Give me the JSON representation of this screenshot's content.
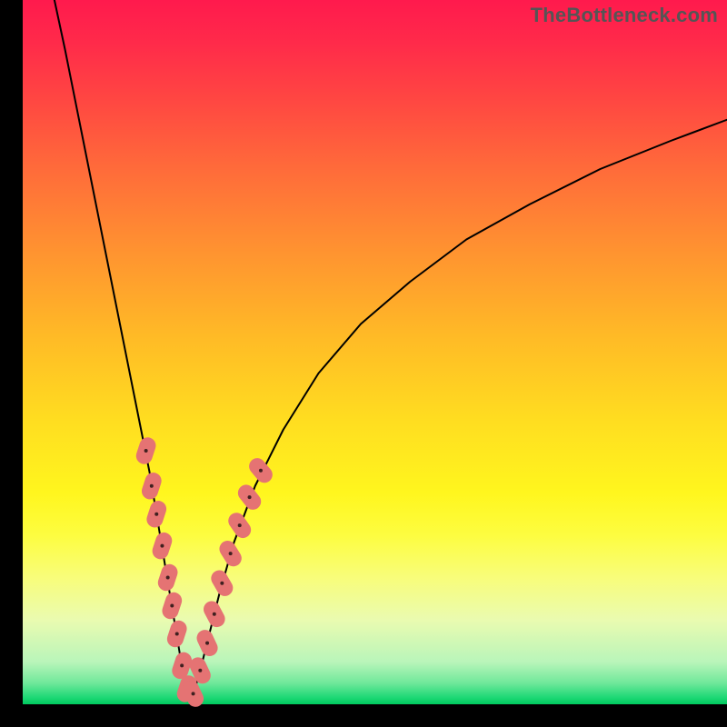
{
  "watermark": "TheBottleneck.com",
  "chart_data": {
    "type": "line",
    "title": "",
    "xlabel": "",
    "ylabel": "",
    "xlim": [
      0,
      100
    ],
    "ylim": [
      0,
      100
    ],
    "notes": "V-shaped bottleneck curve over a red-to-green vertical gradient. Minimum near x≈23.5. Salmon capsule markers cluster along both branches near bottom.",
    "series": [
      {
        "name": "left-branch",
        "x": [
          4.5,
          6,
          8,
          10,
          12,
          14,
          16,
          18,
          19.5,
          21,
          22,
          23,
          23.8
        ],
        "y": [
          100,
          93,
          83,
          73,
          63,
          53,
          43,
          33,
          24,
          15,
          9,
          3,
          0.3
        ]
      },
      {
        "name": "right-branch",
        "x": [
          23.8,
          25,
          26.5,
          28,
          30,
          33,
          37,
          42,
          48,
          55,
          63,
          72,
          82,
          92,
          100
        ],
        "y": [
          0.3,
          4,
          10,
          16,
          23,
          31,
          39,
          47,
          54,
          60,
          66,
          71,
          76,
          80,
          83
        ]
      }
    ],
    "markers": [
      {
        "cx": 17.5,
        "cy": 36,
        "angle": -72
      },
      {
        "cx": 18.3,
        "cy": 31,
        "angle": -72
      },
      {
        "cx": 19.0,
        "cy": 27,
        "angle": -72
      },
      {
        "cx": 19.8,
        "cy": 22.5,
        "angle": -72
      },
      {
        "cx": 20.6,
        "cy": 18,
        "angle": -72
      },
      {
        "cx": 21.2,
        "cy": 14,
        "angle": -72
      },
      {
        "cx": 21.9,
        "cy": 10,
        "angle": -72
      },
      {
        "cx": 22.6,
        "cy": 5.5,
        "angle": -72
      },
      {
        "cx": 23.3,
        "cy": 2.2,
        "angle": -72
      },
      {
        "cx": 24.2,
        "cy": 1.5,
        "angle": 65
      },
      {
        "cx": 25.2,
        "cy": 4.8,
        "angle": 65
      },
      {
        "cx": 26.2,
        "cy": 8.7,
        "angle": 65
      },
      {
        "cx": 27.2,
        "cy": 12.8,
        "angle": 62
      },
      {
        "cx": 28.3,
        "cy": 17.2,
        "angle": 60
      },
      {
        "cx": 29.5,
        "cy": 21.4,
        "angle": 58
      },
      {
        "cx": 30.8,
        "cy": 25.4,
        "angle": 55
      },
      {
        "cx": 32.2,
        "cy": 29.4,
        "angle": 52
      },
      {
        "cx": 33.8,
        "cy": 33.2,
        "angle": 50
      }
    ],
    "marker_style": {
      "fill": "#e57373",
      "rx": 9,
      "length": 30
    }
  }
}
